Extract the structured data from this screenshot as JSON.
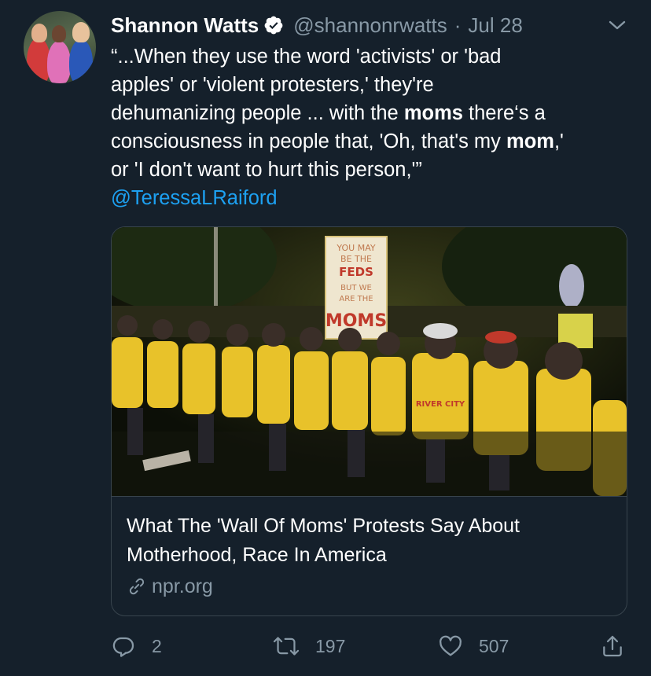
{
  "author": {
    "name": "Shannon Watts",
    "handle": "@shannonrwatts",
    "separator": "·",
    "date": "Jul 28"
  },
  "tweet": {
    "line1": "“...When they use the word 'activists' or 'bad",
    "line2": "apples' or 'violent protesters,' they're",
    "line3_a": "dehumanizing people ... with the ",
    "line3_bold": "moms",
    "line3_b": " there‘s a",
    "line4_a": "consciousness in people that, 'Oh, that's my ",
    "line4_bold": "mom",
    "line4_b": ",'",
    "line5": "or 'I don't want to hurt this person,'”",
    "mention": "@TeressaLRaiford"
  },
  "card": {
    "image_alt": "Protesters in yellow shirts linking arms at night",
    "sign_lines": [
      "YOU MAY",
      "BE THE",
      "FEDS",
      "BUT WE",
      "ARE THE",
      "MOMS"
    ],
    "shirt_text": "RIVER CITY",
    "title_line1": "What The 'Wall Of Moms' Protests Say About",
    "title_line2": "Motherhood, Race In America",
    "domain": "npr.org"
  },
  "actions": {
    "reply_count": "2",
    "retweet_count": "197",
    "like_count": "507"
  },
  "icons": {
    "verified": "verified-badge-icon",
    "caret": "chevron-down-icon",
    "reply": "reply-icon",
    "retweet": "retweet-icon",
    "like": "heart-icon",
    "share": "share-icon",
    "link": "link-icon"
  },
  "colors": {
    "background": "#15202b",
    "secondary_text": "#8899a6",
    "link": "#1da1f2",
    "border": "#38444d"
  }
}
